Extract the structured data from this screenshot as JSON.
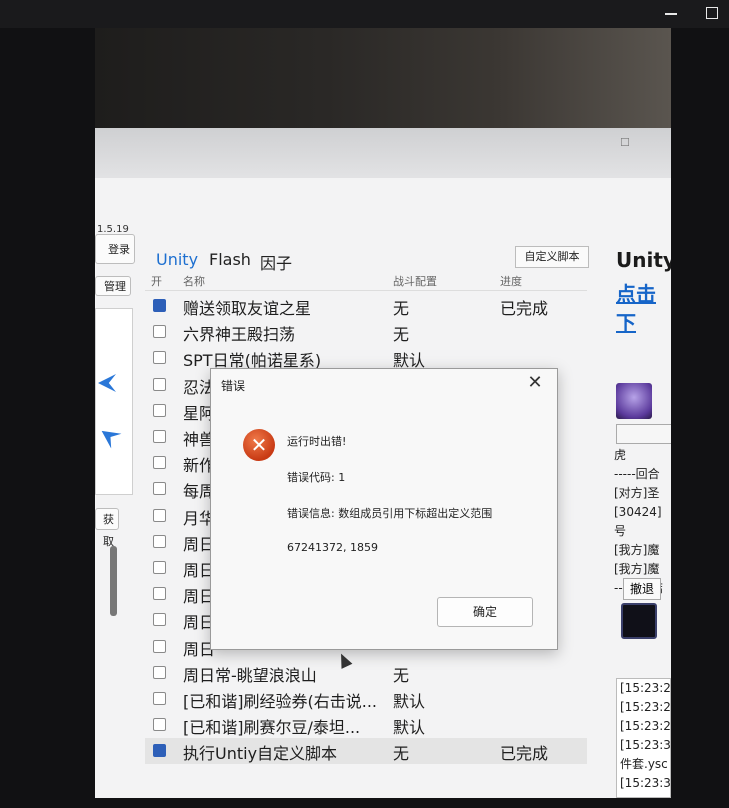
{
  "viewer": {
    "minimize_icon": "minimize-icon",
    "maximize_icon": "maximize-icon"
  },
  "app": {
    "version": "1.5.19",
    "left_buttons": [
      "登录",
      "管理",
      "获取"
    ],
    "tabs": [
      "Unity",
      "Flash",
      "因子"
    ],
    "custom_script_button": "自定义脚本",
    "table": {
      "headers": [
        "开",
        "名称",
        "战斗配置",
        "进度"
      ],
      "rows": [
        {
          "checked": true,
          "name": "赠送领取友谊之星",
          "config": "无",
          "progress": "已完成"
        },
        {
          "checked": false,
          "name": "六界神王殿扫荡",
          "config": "无",
          "progress": ""
        },
        {
          "checked": false,
          "name": "SPT日常(帕诺星系)",
          "config": "默认",
          "progress": ""
        },
        {
          "checked": false,
          "name": "忍法研习社",
          "config": "默认",
          "progress": ""
        },
        {
          "checked": false,
          "name": "星阿",
          "config": "",
          "progress": ""
        },
        {
          "checked": false,
          "name": "神兽",
          "config": "",
          "progress": ""
        },
        {
          "checked": false,
          "name": "新作",
          "config": "",
          "progress": ""
        },
        {
          "checked": false,
          "name": "每周",
          "config": "",
          "progress": ""
        },
        {
          "checked": false,
          "name": "月华",
          "config": "",
          "progress": ""
        },
        {
          "checked": false,
          "name": "周日",
          "config": "",
          "progress": ""
        },
        {
          "checked": false,
          "name": "周日",
          "config": "",
          "progress": ""
        },
        {
          "checked": false,
          "name": "周日",
          "config": "",
          "progress": ""
        },
        {
          "checked": false,
          "name": "周日",
          "config": "",
          "progress": ""
        },
        {
          "checked": false,
          "name": "周日",
          "config": "",
          "progress": ""
        },
        {
          "checked": false,
          "name": "周日常-眺望浪浪山",
          "config": "无",
          "progress": ""
        },
        {
          "checked": false,
          "name": "[已和谐]刷经验券(右击说...",
          "config": "默认",
          "progress": ""
        },
        {
          "checked": false,
          "name": "[已和谐]刷赛尔豆/泰坦...",
          "config": "默认",
          "progress": ""
        },
        {
          "checked": true,
          "name": "执行Untiy自定义脚本",
          "config": "无",
          "progress": "已完成"
        }
      ]
    },
    "right": {
      "title": "Unity",
      "link": "点击下",
      "label": "虎",
      "battle_log": [
        "-----回合",
        "[对方]圣",
        "[30424]号",
        "[我方]魔",
        "[我方]魔",
        "---战斗结"
      ],
      "retreat_button": "撤退",
      "time_log": [
        "[15:23:2",
        "[15:23:2",
        "[15:23:2",
        "[15:23:3",
        "件套.ysc",
        "[15:23:3"
      ]
    }
  },
  "dialog": {
    "title": "错误",
    "close_icon": "close-icon",
    "error_icon": "error-icon",
    "line1": "运行时出错!",
    "line2": "错误代码: 1",
    "line3": "错误信息: 数组成员引用下标超出定义范围",
    "line4": "67241372, 1859",
    "ok_button": "确定"
  }
}
